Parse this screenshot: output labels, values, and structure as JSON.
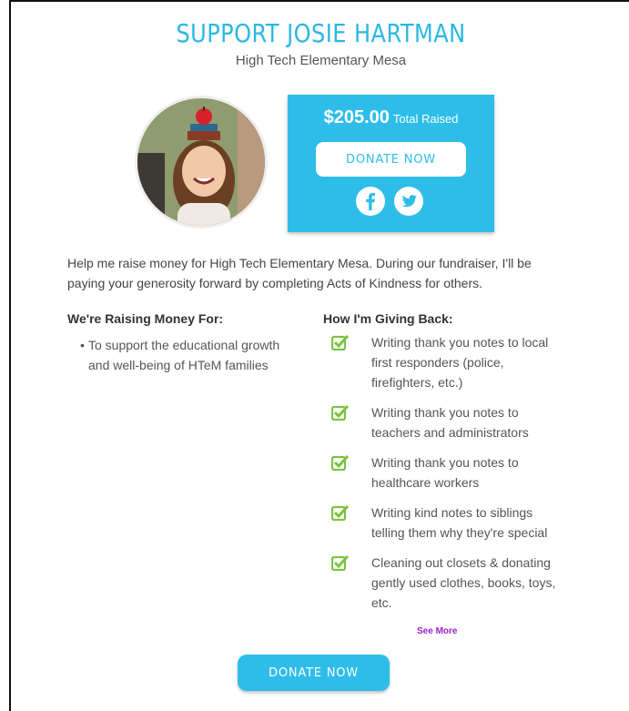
{
  "header": {
    "title": "SUPPORT JOSIE HARTMAN",
    "school": "High Tech Elementary Mesa"
  },
  "donation": {
    "amount": "$205.00",
    "amount_label": "Total Raised",
    "donate_label": "DONATE NOW"
  },
  "social": {
    "facebook_icon": "facebook-icon",
    "twitter_icon": "twitter-icon"
  },
  "intro": "Help me raise money for High Tech Elementary Mesa. During our fundraiser, I'll be paying your generosity forward by completing Acts of Kindness for others.",
  "raising": {
    "heading": "We're Raising Money For:",
    "items": [
      "To support the educational growth and well-being of HTeM families"
    ]
  },
  "giving": {
    "heading": "How I'm Giving Back:",
    "items": [
      "Writing thank you notes to local first responders (police, firefighters, etc.)",
      "Writing thank you notes to teachers and administrators",
      "Writing thank you notes to healthcare workers",
      "Writing kind notes to siblings telling them why they're special",
      "Cleaning out closets & donating gently used clothes, books, toys, etc."
    ],
    "see_more": "See More"
  },
  "footer": {
    "donate_label": "DONATE NOW"
  },
  "colors": {
    "accent": "#2ebde9",
    "check": "#7cc242",
    "link": "#9b1fd1"
  }
}
